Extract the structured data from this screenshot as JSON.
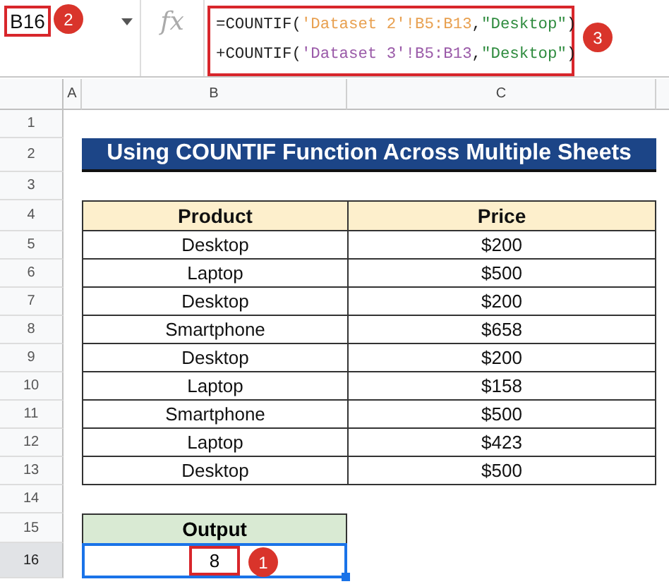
{
  "name_box": {
    "value": "B16",
    "badge": "2"
  },
  "formula_bar": {
    "fx": "fx",
    "badge": "3",
    "lines": [
      [
        {
          "text": "=COUNTIF(",
          "color": "#222222"
        },
        {
          "text": "'Dataset 2'!B5:B13",
          "color": "#e8a050"
        },
        {
          "text": ",",
          "color": "#222222"
        },
        {
          "text": "\"Desktop\"",
          "color": "#2e8b3e"
        },
        {
          "text": ")",
          "color": "#222222"
        }
      ],
      [
        {
          "text": "+COUNTIF(",
          "color": "#222222"
        },
        {
          "text": "'Dataset 3'!B5:B13",
          "color": "#9a5aa8"
        },
        {
          "text": ",",
          "color": "#222222"
        },
        {
          "text": "\"Desktop\"",
          "color": "#2e8b3e"
        },
        {
          "text": ")",
          "color": "#222222"
        }
      ]
    ]
  },
  "columns": [
    "A",
    "B",
    "C"
  ],
  "rows": [
    {
      "number": "1",
      "kind": "blank",
      "selected": false
    },
    {
      "number": "2",
      "kind": "title",
      "selected": false,
      "text": "Using COUNTIF Function Across Multiple Sheets"
    },
    {
      "number": "3",
      "kind": "blank",
      "selected": false
    },
    {
      "number": "4",
      "kind": "header",
      "selected": false,
      "cells": [
        "Product",
        "Price"
      ]
    },
    {
      "number": "5",
      "kind": "data",
      "selected": false,
      "cells": [
        "Desktop",
        "$200"
      ]
    },
    {
      "number": "6",
      "kind": "data",
      "selected": false,
      "cells": [
        "Laptop",
        "$500"
      ]
    },
    {
      "number": "7",
      "kind": "data",
      "selected": false,
      "cells": [
        "Desktop",
        "$200"
      ]
    },
    {
      "number": "8",
      "kind": "data",
      "selected": false,
      "cells": [
        "Smartphone",
        "$658"
      ]
    },
    {
      "number": "9",
      "kind": "data",
      "selected": false,
      "cells": [
        "Desktop",
        "$200"
      ]
    },
    {
      "number": "10",
      "kind": "data",
      "selected": false,
      "cells": [
        "Laptop",
        "$158"
      ]
    },
    {
      "number": "11",
      "kind": "data",
      "selected": false,
      "cells": [
        "Smartphone",
        "$500"
      ]
    },
    {
      "number": "12",
      "kind": "data",
      "selected": false,
      "cells": [
        "Laptop",
        "$423"
      ]
    },
    {
      "number": "13",
      "kind": "data",
      "selected": false,
      "cells": [
        "Desktop",
        "$500"
      ]
    },
    {
      "number": "14",
      "kind": "blank",
      "selected": false
    },
    {
      "number": "15",
      "kind": "output_header",
      "selected": false,
      "text": "Output"
    },
    {
      "number": "16",
      "kind": "output",
      "selected": true,
      "text": "8",
      "badge": "1"
    }
  ]
}
